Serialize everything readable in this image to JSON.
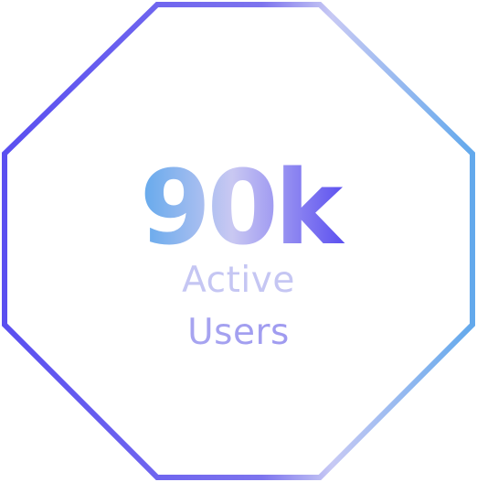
{
  "badge": {
    "value": "90k",
    "label_line_1": "Active",
    "label_line_2": "Users"
  },
  "colors": {
    "gradient_blue": "#63a9ec",
    "gradient_pale": "#c9c8f2",
    "gradient_purple": "#5b4ff0"
  }
}
